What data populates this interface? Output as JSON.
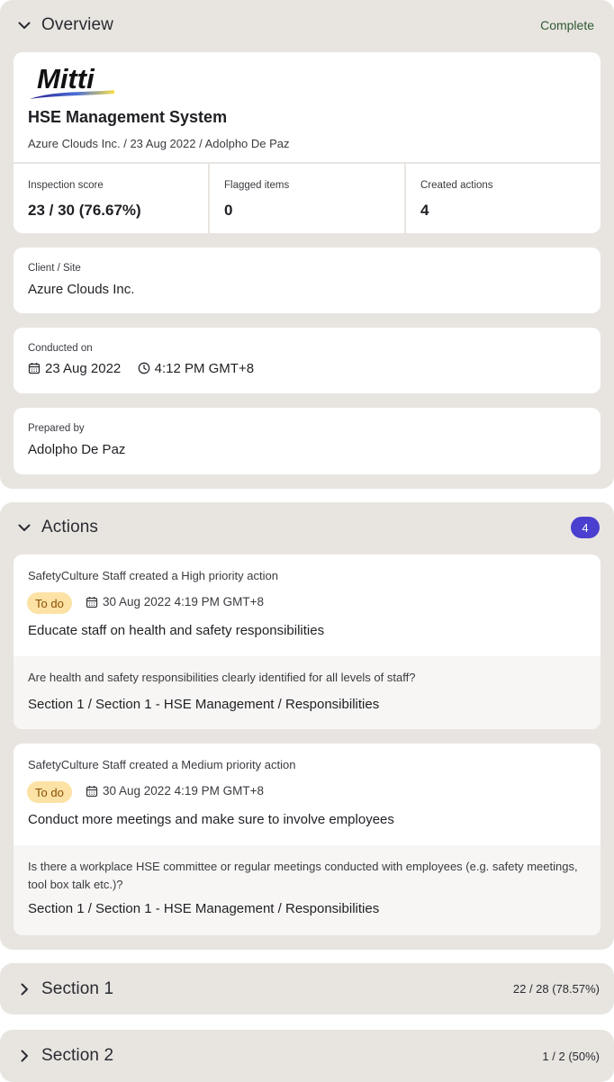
{
  "overview": {
    "title": "Overview",
    "status": "Complete",
    "logo_text": "Mitti",
    "report_title": "HSE Management System",
    "report_subtitle": "Azure Clouds Inc. / 23 Aug 2022 / Adolpho De Paz",
    "stats": [
      {
        "label": "Inspection score",
        "value": "23 / 30 (76.67%)"
      },
      {
        "label": "Flagged items",
        "value": "0"
      },
      {
        "label": "Created actions",
        "value": "4"
      }
    ],
    "client_site": {
      "label": "Client / Site",
      "value": "Azure Clouds Inc."
    },
    "conducted_on": {
      "label": "Conducted on",
      "date": "23 Aug 2022",
      "time": "4:12 PM GMT+8"
    },
    "prepared_by": {
      "label": "Prepared by",
      "value": "Adolpho De Paz"
    }
  },
  "actions": {
    "title": "Actions",
    "count": "4",
    "items": [
      {
        "creator_line": "SafetyCulture Staff created a High priority action",
        "status": "To do",
        "date": "30 Aug 2022 4:19 PM GMT+8",
        "title": "Educate staff on health and safety responsibilities",
        "question": "Are health and safety responsibilities clearly identified for all levels of staff?",
        "path": "Section 1 / Section 1 - HSE Management / Responsibilities"
      },
      {
        "creator_line": "SafetyCulture Staff created a Medium priority action",
        "status": "To do",
        "date": "30 Aug 2022 4:19 PM GMT+8",
        "title": "Conduct more meetings and make sure to involve employees",
        "question": "Is there a workplace HSE committee or regular meetings conducted with employees (e.g. safety meetings, tool box talk etc.)?",
        "path": "Section 1 / Section 1 - HSE Management / Responsibilities"
      }
    ]
  },
  "sections": [
    {
      "title": "Section 1",
      "score": "22 / 28 (78.57%)"
    },
    {
      "title": "Section 2",
      "score": "1 / 2 (50%)"
    }
  ],
  "colors": {
    "panel_bg": "#e8e5e1",
    "badge_bg": "#4a3fcf",
    "todo_bg": "#fde2a6",
    "todo_text": "#8a4e00",
    "complete_text": "#2f5a32"
  },
  "icons": [
    "chevron-down-icon",
    "chevron-right-icon",
    "calendar-icon",
    "clock-icon"
  ]
}
